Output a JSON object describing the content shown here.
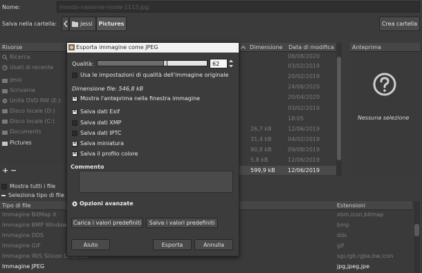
{
  "save_dialog": {
    "name_label": "Nome:",
    "name_value": "mondo-navonne-mode-1113.jpg",
    "folder_label": "Salva nella cartella:",
    "breadcrumb": [
      "jessi",
      "Pictures"
    ],
    "create_folder": "Crea cartella",
    "places_header": "Risorse",
    "places": [
      {
        "label": "Ricerca",
        "icon": "search-icon"
      },
      {
        "label": "Usati di recente",
        "icon": "clock-icon"
      },
      {
        "label": "jessi",
        "icon": "home-folder-icon"
      },
      {
        "label": "Scrivania",
        "icon": "desktop-folder-icon"
      },
      {
        "label": "Unità DVD RW (E:)",
        "icon": "optical-drive-icon"
      },
      {
        "label": "Disco locale (D:)",
        "icon": "drive-icon"
      },
      {
        "label": "Disco locale (C:)",
        "icon": "drive-icon"
      },
      {
        "label": "Documents",
        "icon": "folder-icon"
      },
      {
        "label": "Pictures",
        "icon": "folder-icon"
      }
    ],
    "columns": {
      "size": "Dimensione",
      "date": "Data di modifica"
    },
    "files": [
      {
        "size": "",
        "date": "06/08/2020"
      },
      {
        "size": "",
        "date": "03/02/2019"
      },
      {
        "size": "",
        "date": "20/02/2019"
      },
      {
        "size": "",
        "date": "24/06/2020"
      },
      {
        "size": "",
        "date": "20/04/2020"
      },
      {
        "size": "",
        "date": "03/02/2019"
      },
      {
        "size": "",
        "date": "18:05"
      },
      {
        "size": "26,7 kB",
        "date": "12/06/2019"
      },
      {
        "size": "31,4 kB",
        "date": "04/02/2019"
      },
      {
        "size": "90,8 kB",
        "date": "09/08/2019"
      },
      {
        "size": "5,8 kB",
        "date": "12/06/2019"
      },
      {
        "size": "599,9 kB",
        "date": "12/06/2019"
      }
    ],
    "preview_header": "Anteprima",
    "preview_text": "Nessuna selezione",
    "add_symbol": "+",
    "remove_symbol": "−",
    "show_all_files": "Mostra tutti i file",
    "select_file_type": "Seleziona tipo di file",
    "file_type_header": "Tipo di file",
    "extensions_header": "Estensioni",
    "file_types": [
      {
        "name": "Immagine BitMap X",
        "ext": "xbm,icon,bitmap"
      },
      {
        "name": "Immagine BMP Windows",
        "ext": "bmp"
      },
      {
        "name": "Immagine DDS",
        "ext": "dds"
      },
      {
        "name": "Immagine GIF",
        "ext": "gif"
      },
      {
        "name": "Immagine IRIS Silicon Graphics",
        "ext": "sgi,rgb,rgba,bw,icon"
      },
      {
        "name": "Immagine JPEG",
        "ext": "jpg,jpeg,jpe"
      }
    ]
  },
  "export_dialog": {
    "title": "Esporta immagine come JPEG",
    "quality_label": "Qualità:",
    "quality_value": "62",
    "quality_level": 0.62,
    "use_original_quality": "Usa le impostazioni di qualità dell'immagine originale",
    "file_size": "Dimensione file: 546,8 kB",
    "options": [
      {
        "label": "Mostra l'anteprima nella finestra immagine",
        "checked": true
      },
      {
        "label": "Salva dati Exif",
        "checked": true
      },
      {
        "label": "Salva dati XMP",
        "checked": false
      },
      {
        "label": "Salva dati IPTC",
        "checked": false
      },
      {
        "label": "Salva miniatura",
        "checked": true
      },
      {
        "label": "Salva il profilo colore",
        "checked": true
      }
    ],
    "comment_label": "Commento",
    "advanced_options": "Opzioni avanzate",
    "load_defaults": "Carica i valori predefiniti",
    "save_defaults": "Salva i valori predefiniti",
    "help": "Aiuto",
    "export": "Esporta",
    "cancel": "Annulla"
  }
}
